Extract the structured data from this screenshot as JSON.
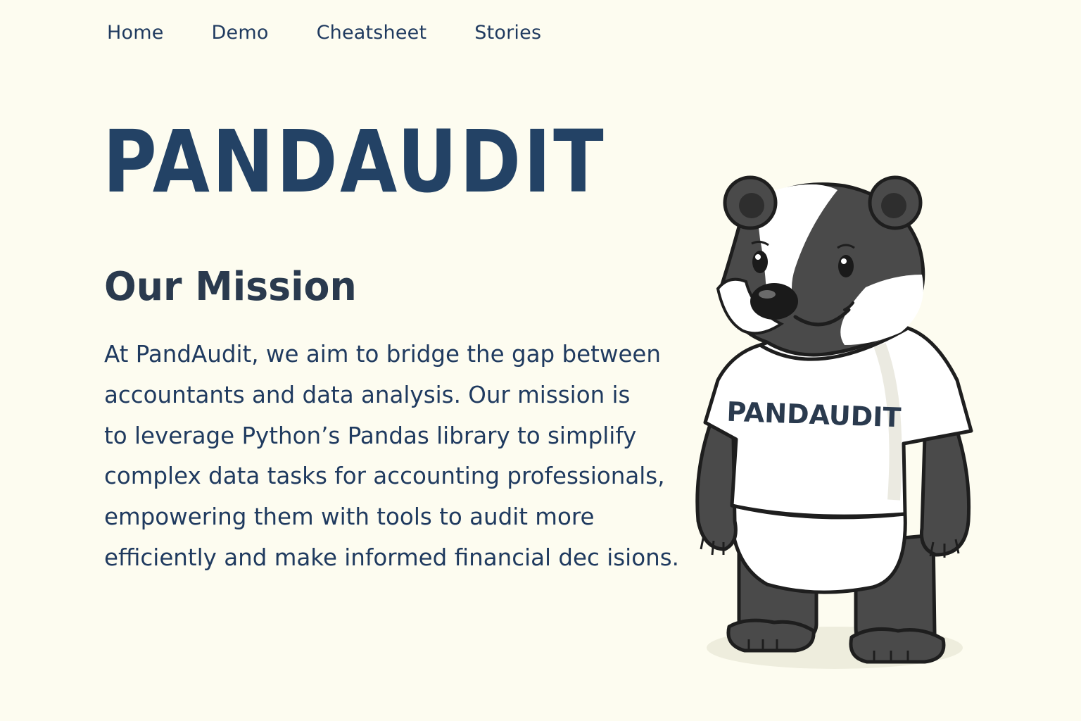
{
  "nav": {
    "items": [
      {
        "label": "Home"
      },
      {
        "label": "Demo"
      },
      {
        "label": "Cheatsheet"
      },
      {
        "label": "Stories"
      }
    ]
  },
  "hero": {
    "title": "PANDAUDIT"
  },
  "mission": {
    "heading": "Our Mission",
    "lines": [
      "At PandAudit, we aim to bridge the gap between",
      "accountants and data analysis. Our mission is",
      "to leverage Python’s Pandas library to simplify",
      "complex data tasks for accounting professionals,",
      "empowering them with tools to audit more",
      "efficiently and make informed financial dec isions."
    ]
  },
  "mascot": {
    "shirt_text": "PANDAUDIT",
    "icon": "badger-mascot-illustration"
  },
  "colors": {
    "background": "#fdfcf0",
    "brand_navy": "#234265",
    "text_navy": "#1f3a5f",
    "heading_slate": "#2a3a4e",
    "fur_dark": "#4a4a4a"
  }
}
